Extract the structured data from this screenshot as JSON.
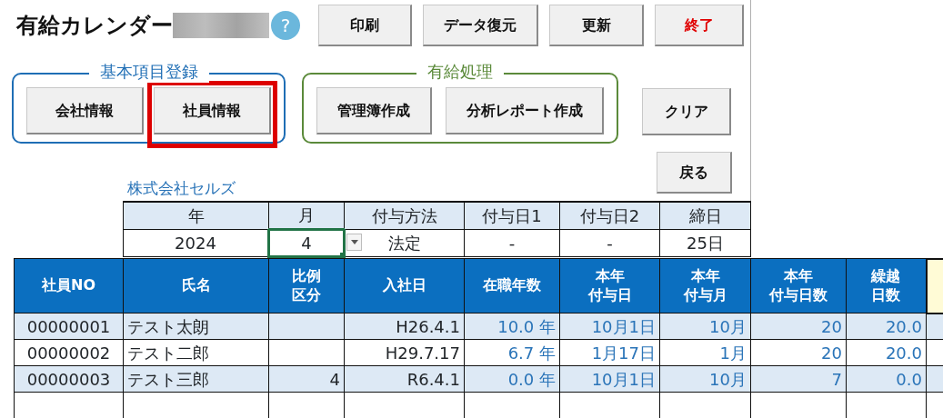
{
  "title": "有給カレンダー",
  "help_button": "?",
  "toolbar_buttons": [
    {
      "label": "印刷",
      "kind": "normal"
    },
    {
      "label": "データ復元",
      "kind": "normal"
    },
    {
      "label": "更新",
      "kind": "normal"
    },
    {
      "label": "終了",
      "kind": "danger"
    }
  ],
  "groups": [
    {
      "legend": "基本項目登録",
      "color": "#1f6eb5",
      "buttons": [
        {
          "label": "会社情報",
          "highlighted": false
        },
        {
          "label": "社員情報",
          "highlighted": true
        }
      ]
    },
    {
      "legend": "有給処理",
      "color": "#5b8a3a",
      "buttons": [
        {
          "label": "管理簿作成",
          "highlighted": false
        },
        {
          "label": "分析レポート作成",
          "highlighted": false
        }
      ]
    }
  ],
  "clear_button": "クリア",
  "back_button": "戻る",
  "company": "株式会社セルズ",
  "settings": {
    "columns": [
      "年",
      "月",
      "付与方法",
      "付与日1",
      "付与日2",
      "締日"
    ],
    "values": [
      {
        "text": "2024",
        "selected": false,
        "dropdown": false
      },
      {
        "text": "4",
        "selected": true,
        "dropdown": true
      },
      {
        "text": "法定",
        "selected": false,
        "dropdown": false
      },
      {
        "text": "-",
        "selected": false,
        "dropdown": false
      },
      {
        "text": "-",
        "selected": false,
        "dropdown": false
      },
      {
        "text": "25日",
        "selected": false,
        "dropdown": false
      }
    ]
  },
  "table": {
    "columns": [
      [
        "社員NO"
      ],
      [
        "氏名"
      ],
      [
        "比例",
        "区分"
      ],
      [
        "入社日"
      ],
      [
        "在職年数"
      ],
      [
        "本年",
        "付与日"
      ],
      [
        "本年",
        "付与月"
      ],
      [
        "本年",
        "付与日数"
      ],
      [
        "繰越",
        "日数"
      ]
    ],
    "rows": [
      {
        "no": "00000001",
        "name": "テスト太朗",
        "hire_date": "H26.4.1",
        "years": "10.0 年",
        "grant_date": "10月1日",
        "grant_month": "10月",
        "grant_days": "20",
        "carry_days": "20.0"
      },
      {
        "no": "00000002",
        "name": "テスト二郎",
        "hire_date": "H29.7.17",
        "years": "6.7 年",
        "grant_date": "1月17日",
        "grant_month": "1月",
        "grant_days": "20",
        "carry_days": "20.0"
      },
      {
        "no": "00000003",
        "name": "テスト三郎",
        "ratio": "4",
        "hire_date": "R6.4.1",
        "years": "0.0 年",
        "grant_date": "10月1日",
        "grant_month": "10月",
        "grant_days": "7",
        "carry_days": "0.0"
      }
    ]
  }
}
